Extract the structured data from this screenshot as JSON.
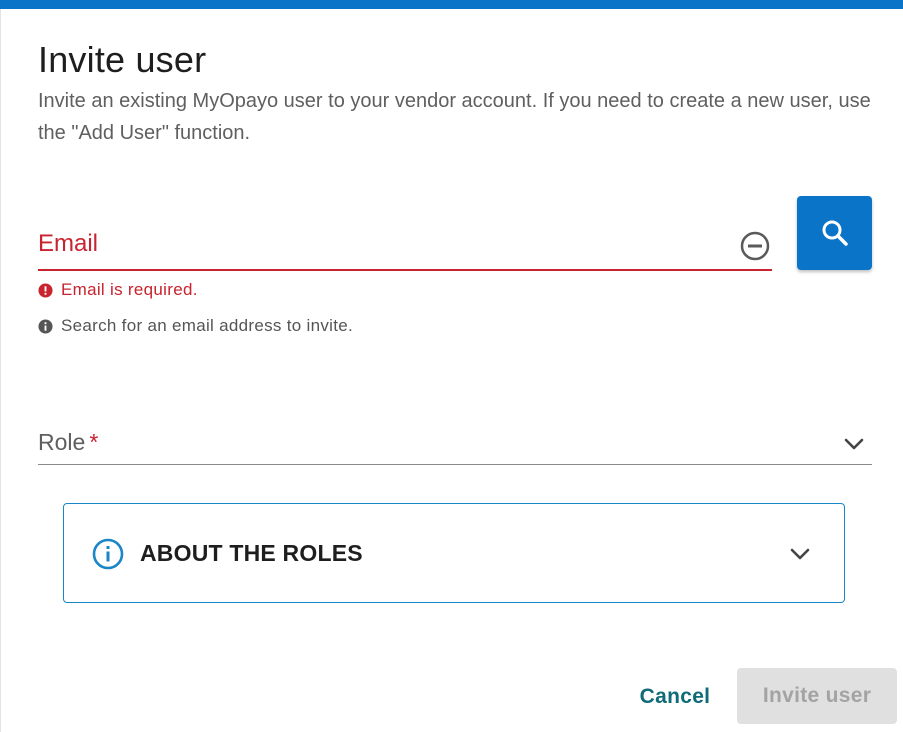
{
  "dialog": {
    "title": "Invite user",
    "subtitle": "Invite an existing MyOpayo user to your vendor account. If you need to create a new user, use the \"Add User\" function."
  },
  "email": {
    "label": "Email",
    "error_message": "Email is required.",
    "hint_message": "Search for an email address to invite.",
    "icons": {
      "clear": "minus-circle-icon",
      "search": "search-icon",
      "error": "error-icon",
      "info": "info-icon"
    }
  },
  "role": {
    "label": "Role",
    "required_marker": "*",
    "icon": "chevron-down-icon"
  },
  "about_roles": {
    "label": "ABOUT THE ROLES",
    "icon": "info-circle-icon",
    "expand_icon": "chevron-down-icon"
  },
  "actions": {
    "cancel_label": "Cancel",
    "invite_label": "Invite user"
  },
  "colors": {
    "primary": "#0a74c9",
    "error": "#c8232e",
    "cancel_text": "#0f6b77",
    "disabled_bg": "#e0e0e0",
    "disabled_text": "#a3a3a3"
  }
}
